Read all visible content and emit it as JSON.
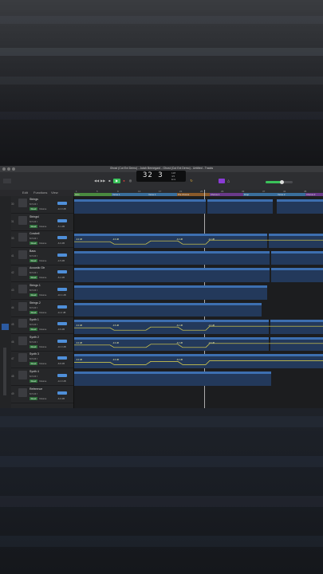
{
  "window": {
    "title": "Ghost (Cut Ext Demo) - Jutah Bernegard - Ghost (Cut Ext Demo) - Untitled - Tracks"
  },
  "toolbar": {
    "lcd_position": "32 3",
    "lcd_tempo_top": "128",
    "lcd_tempo_bottom": "4/4",
    "lcd_key": "Emi"
  },
  "subbar": {
    "edit": "Edit",
    "functions": "Functions",
    "view": "View",
    "snap_label": "Snap:",
    "snap_value": "Smart",
    "drag_label": "Drag:",
    "drag_value": "X-Fade"
  },
  "ruler": {
    "ticks": [
      "1",
      "5",
      "9",
      "13",
      "17",
      "21",
      "25",
      "29",
      "33",
      "37",
      "41",
      "45"
    ],
    "markers": [
      "Intro",
      "Verse 1",
      "Verse 1",
      "Pre Chorus",
      "Chorus 1",
      "Drop",
      "Verse 2",
      "Chorus 2"
    ]
  },
  "tracks": [
    {
      "num": "30",
      "name": "Strings",
      "read": "Read",
      "vol": "Volume",
      "db": "-12.0 dB"
    },
    {
      "num": "31",
      "name": "Stringsl",
      "read": "Read",
      "vol": "Volume",
      "db": "-5.1 dB"
    },
    {
      "num": "33",
      "name": "Cowbell",
      "read": "Read",
      "vol": "Volume",
      "db": "-6.0 dB"
    },
    {
      "num": "41",
      "name": "Bass",
      "read": "Read",
      "vol": "Volume",
      "db": "-4.5 dB"
    },
    {
      "num": "42",
      "name": "Acoustic Gtr",
      "read": "Read",
      "vol": "Volume",
      "db": "-8.2 dB"
    },
    {
      "num": "43",
      "name": "Strings 1",
      "read": "Read",
      "vol": "Volume",
      "db": "-10.4 dB"
    },
    {
      "num": "44",
      "name": "Strings 2",
      "read": "Read",
      "vol": "Volume",
      "db": "-11.2 dB"
    },
    {
      "num": "45",
      "name": "Synth 1",
      "read": "Read",
      "vol": "Volume",
      "db": "-9.6 dB"
    },
    {
      "num": "46",
      "name": "Synth 2",
      "read": "Read",
      "vol": "Volume",
      "db": "-10.0 dB"
    },
    {
      "num": "47",
      "name": "Synth 3",
      "read": "Read",
      "vol": "Volume",
      "db": "-8.8 dB"
    },
    {
      "num": "48",
      "name": "Synth 4",
      "read": "Read",
      "vol": "Volume",
      "db": "-12.0 dB"
    },
    {
      "num": "49",
      "name": "Reference",
      "read": "Read",
      "vol": "Volume",
      "db": "-6.0 dB"
    }
  ],
  "regions": [
    {
      "name": "Strings",
      "row": 0
    },
    {
      "name": "Strings",
      "row": 0
    },
    {
      "name": "Strings",
      "row": 0
    },
    {
      "name": "Cowbell",
      "row": 2
    },
    {
      "name": "Cowbell",
      "row": 2
    },
    {
      "name": "Bass",
      "row": 3
    },
    {
      "name": "Bass",
      "row": 3
    },
    {
      "name": "Acoustic Gtr",
      "row": 4
    },
    {
      "name": "Acoustic Gtr",
      "row": 4
    },
    {
      "name": "Strings 1",
      "row": 5
    },
    {
      "name": "Strings 2",
      "row": 6
    },
    {
      "name": "Synth 1",
      "row": 7
    },
    {
      "name": "Synth 1",
      "row": 7
    },
    {
      "name": "Synth 2",
      "row": 8
    },
    {
      "name": "Synth 2",
      "row": 8
    },
    {
      "name": "Synth 3",
      "row": 9
    },
    {
      "name": "Synth 4",
      "row": 10
    }
  ],
  "automation_labels": [
    "-6.0 dB",
    "-9.0 dB",
    "-6.0 dB",
    "-4.2 dB",
    "-6.0 dB",
    "-9.8 dB",
    "-6.2 dB",
    "-4.6 dB",
    "-6.0 dB",
    "-9.0 dB",
    "-6.0 dB",
    "-4.8 dB",
    "-6.0 dB",
    "-9.0 dB",
    "-6.0 dB"
  ],
  "colors": {
    "region_header": "#3d6fb0",
    "region_body": "#23395b",
    "read_green": "#2c6e39",
    "fader_blue": "#4f8fd9",
    "play_green": "#3ac25a",
    "record_red": "#e0403c"
  },
  "icons": [
    "play-icon",
    "stop-icon",
    "record-icon",
    "rewind-icon",
    "forward-icon",
    "cycle-icon",
    "metronome-icon"
  ]
}
